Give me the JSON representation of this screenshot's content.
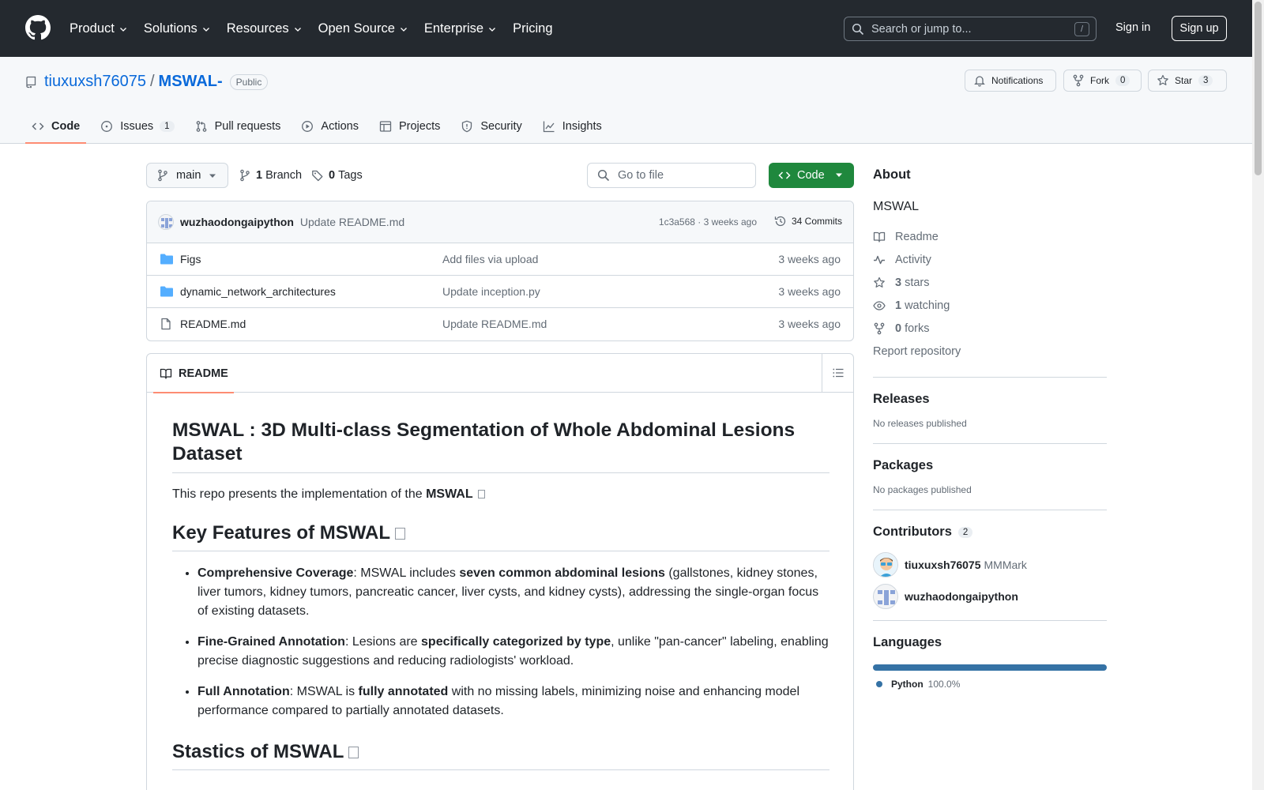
{
  "header": {
    "nav": [
      {
        "label": "Product",
        "has_dropdown": true
      },
      {
        "label": "Solutions",
        "has_dropdown": true
      },
      {
        "label": "Resources",
        "has_dropdown": true
      },
      {
        "label": "Open Source",
        "has_dropdown": true
      },
      {
        "label": "Enterprise",
        "has_dropdown": true
      },
      {
        "label": "Pricing",
        "has_dropdown": false
      }
    ],
    "search_placeholder": "Search or jump to...",
    "search_shortcut": "/",
    "sign_in": "Sign in",
    "sign_up": "Sign up"
  },
  "repo": {
    "owner": "tiuxuxsh76075",
    "separator": "/",
    "name": "MSWAL-",
    "visibility": "Public",
    "notifications_label": "Notifications",
    "fork_label": "Fork",
    "fork_count": "0",
    "star_label": "Star",
    "star_count": "3"
  },
  "tabs": [
    {
      "label": "Code",
      "icon": "code-icon",
      "active": true
    },
    {
      "label": "Issues",
      "icon": "issue-icon",
      "count": "1"
    },
    {
      "label": "Pull requests",
      "icon": "pull-request-icon"
    },
    {
      "label": "Actions",
      "icon": "play-icon"
    },
    {
      "label": "Projects",
      "icon": "table-icon"
    },
    {
      "label": "Security",
      "icon": "shield-icon"
    },
    {
      "label": "Insights",
      "icon": "graph-icon"
    }
  ],
  "file_nav": {
    "branch": "main",
    "branch_count": "1",
    "branch_label": "Branch",
    "tag_count": "0",
    "tag_label": "Tags",
    "goto_placeholder": "Go to file",
    "code_button": "Code"
  },
  "latest_commit": {
    "author": "wuzhaodongaipython",
    "message": "Update README.md",
    "meta": "1c3a568 · 3 weeks ago",
    "commits": "34 Commits"
  },
  "files": [
    {
      "type": "folder",
      "name": "Figs",
      "message": "Add files via upload",
      "time": "3 weeks ago"
    },
    {
      "type": "folder",
      "name": "dynamic_network_architectures",
      "message": "Update inception.py",
      "time": "3 weeks ago"
    },
    {
      "type": "file",
      "name": "README.md",
      "message": "Update README.md",
      "time": "3 weeks ago"
    }
  ],
  "readme": {
    "tab_label": "README",
    "title": "MSWAL : 3D Multi-class Segmentation of Whole Abdominal Lesions Dataset",
    "intro_text": "This repo presents the implementation of the ",
    "intro_bold": "MSWAL",
    "h2_features": "Key Features of MSWAL",
    "features": [
      {
        "label": "Comprehensive Coverage",
        "text1": ": MSWAL includes ",
        "bold": "seven common abdominal lesions",
        "text2": " (gallstones, kidney stones, liver tumors, kidney tumors, pancreatic cancer, liver cysts, and kidney cysts), addressing the single-organ focus of existing datasets."
      },
      {
        "label": "Fine-Grained Annotation",
        "text1": ": Lesions are ",
        "bold": "specifically categorized by type",
        "text2": ", unlike \"pan-cancer\" labeling, enabling precise diagnostic suggestions and reducing radiologists' workload."
      },
      {
        "label": "Full Annotation",
        "text1": ": MSWAL is ",
        "bold": "fully annotated",
        "text2": " with no missing labels, minimizing noise and enhancing model performance compared to partially annotated datasets."
      }
    ],
    "h2_stats": "Stastics of MSWAL"
  },
  "about": {
    "heading": "About",
    "description": "MSWAL",
    "links": [
      {
        "icon": "book-icon",
        "count": "",
        "label": "Readme"
      },
      {
        "icon": "pulse-icon",
        "count": "",
        "label": "Activity"
      },
      {
        "icon": "star-icon",
        "count": "3",
        "label": "stars"
      },
      {
        "icon": "eye-icon",
        "count": "1",
        "label": "watching"
      },
      {
        "icon": "fork-icon",
        "count": "0",
        "label": "forks"
      }
    ],
    "report": "Report repository"
  },
  "releases": {
    "heading": "Releases",
    "text": "No releases published"
  },
  "packages": {
    "heading": "Packages",
    "text": "No packages published"
  },
  "contributors": {
    "heading": "Contributors",
    "count": "2",
    "people": [
      {
        "login": "tiuxuxsh76075",
        "alias": "MMMark"
      },
      {
        "login": "wuzhaodongaipython",
        "alias": ""
      }
    ]
  },
  "languages": {
    "heading": "Languages",
    "items": [
      {
        "name": "Python",
        "percent": "100.0%",
        "color": "#3572A5"
      }
    ]
  },
  "colors": {
    "header_bg": "#24292f",
    "link": "#0969da",
    "active_tab_underline": "#fd8c73",
    "code_button": "#1f883d"
  }
}
